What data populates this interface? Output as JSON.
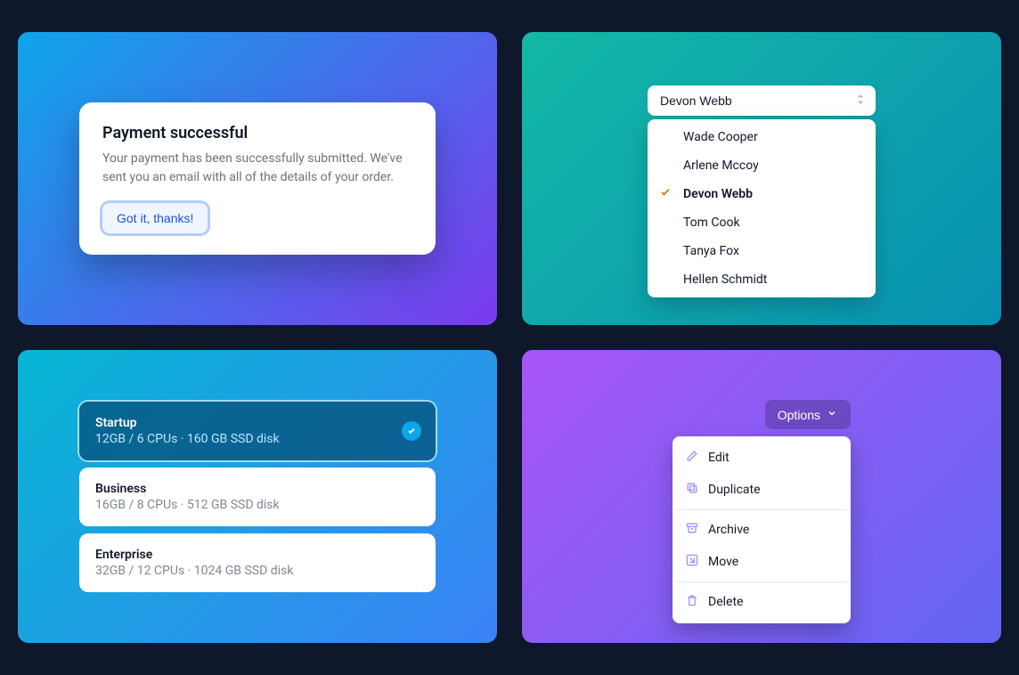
{
  "dialog": {
    "title": "Payment successful",
    "body": "Your payment has been successfully submitted. We've sent you an email with all of the details of your order.",
    "button": "Got it, thanks!"
  },
  "listbox": {
    "selected": "Devon Webb",
    "options": [
      {
        "label": "Wade Cooper",
        "selected": false
      },
      {
        "label": "Arlene Mccoy",
        "selected": false
      },
      {
        "label": "Devon Webb",
        "selected": true
      },
      {
        "label": "Tom Cook",
        "selected": false
      },
      {
        "label": "Tanya Fox",
        "selected": false
      },
      {
        "label": "Hellen Schmidt",
        "selected": false
      }
    ]
  },
  "plans": [
    {
      "name": "Startup",
      "desc": "12GB / 6 CPUs · 160 GB SSD disk",
      "selected": true
    },
    {
      "name": "Business",
      "desc": "16GB / 8 CPUs · 512 GB SSD disk",
      "selected": false
    },
    {
      "name": "Enterprise",
      "desc": "32GB / 12 CPUs · 1024 GB SSD disk",
      "selected": false
    }
  ],
  "menu": {
    "button": "Options",
    "items": {
      "edit": "Edit",
      "duplicate": "Duplicate",
      "archive": "Archive",
      "move": "Move",
      "delete": "Delete"
    }
  }
}
